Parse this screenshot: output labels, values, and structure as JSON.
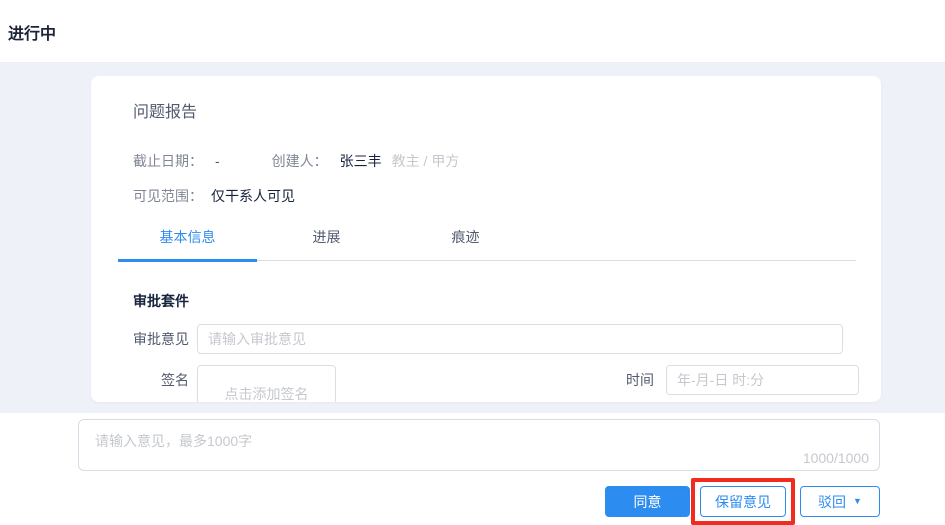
{
  "page": {
    "status_title": "进行中"
  },
  "card": {
    "title": "问题报告",
    "meta": {
      "deadline_label": "截止日期：",
      "deadline_value": "-",
      "creator_label": "创建人：",
      "creator_name": "张三丰",
      "creator_role": "教主 / 甲方",
      "visibility_label": "可见范围：",
      "visibility_value": "仅干系人可见"
    },
    "tabs": {
      "basic": "基本信息",
      "progress": "进展",
      "trace": "痕迹"
    },
    "approval": {
      "section_title": "审批套件",
      "opinion_label": "审批意见",
      "opinion_placeholder": "请输入审批意见",
      "signature_label": "签名",
      "signature_placeholder": "点击添加签名",
      "time_label": "时间",
      "time_placeholder": "年-月-日 时:分"
    }
  },
  "footer": {
    "comment_placeholder": "请输入意见，最多1000字",
    "counter": "1000/1000",
    "agree_label": "同意",
    "reserve_label": "保留意见",
    "reject_label": "驳回",
    "caret_icon": "▼"
  },
  "colors": {
    "primary": "#2d8cf0",
    "annotation_red": "#f12b1d",
    "band_background": "#eef1f8"
  }
}
